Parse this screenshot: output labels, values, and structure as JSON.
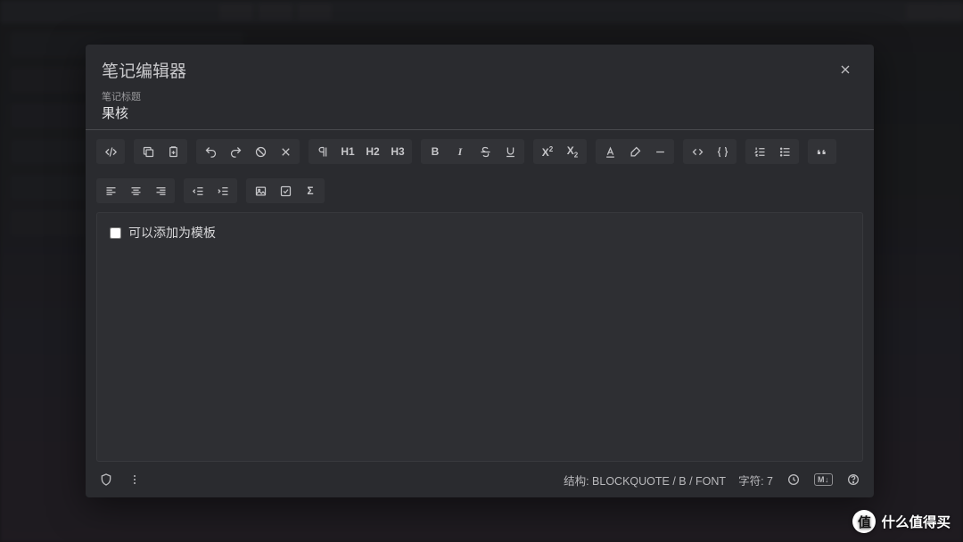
{
  "modal": {
    "title": "笔记编辑器",
    "title_field_label": "笔记标题",
    "title_value": "果核"
  },
  "toolbar": {
    "h1": "H1",
    "h2": "H2",
    "h3": "H3",
    "bold": "B",
    "italic": "I",
    "sup_base": "X",
    "sup_exp": "2",
    "sub_base": "X",
    "sub_exp": "2",
    "sigma": "Σ"
  },
  "editor": {
    "checkbox_label": "可以添加为模板"
  },
  "footer": {
    "structure_label": "结构:",
    "structure_value": "BLOCKQUOTE / B / FONT",
    "chars_label": "字符:",
    "chars_value": "7",
    "md_badge": "M↓"
  },
  "watermark": {
    "badge": "值",
    "text": "什么值得买"
  }
}
